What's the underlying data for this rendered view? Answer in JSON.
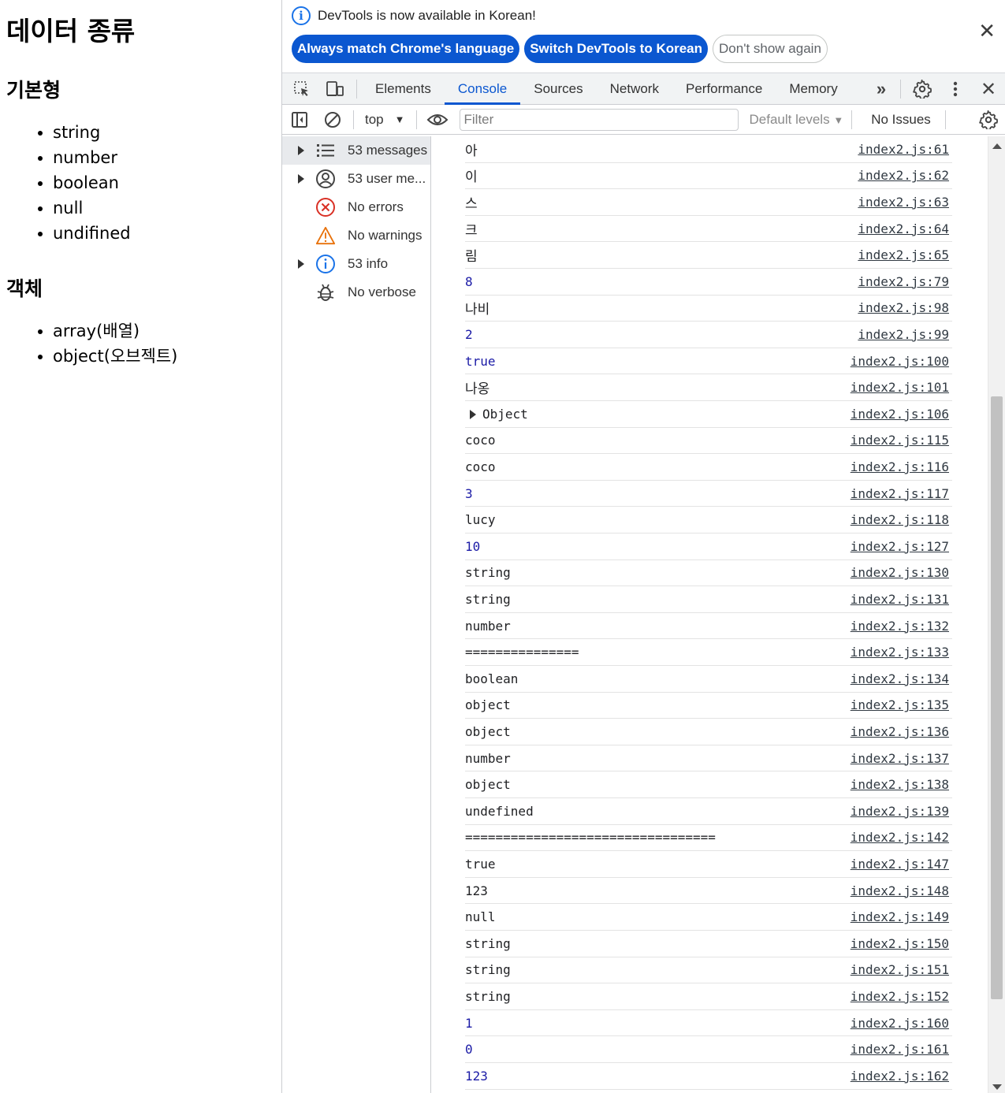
{
  "page": {
    "title": "데이터 종류",
    "section1_title": "기본형",
    "primitives": [
      "string",
      "number",
      "boolean",
      "null",
      "undifined"
    ],
    "section2_title": "객체",
    "objects": [
      "array(배열)",
      "object(오브젝트)"
    ]
  },
  "infobar": {
    "message": "DevTools is now available in Korean!",
    "btn_match": "Always match Chrome's language",
    "btn_switch": "Switch DevTools to Korean",
    "btn_dismiss": "Don't show again"
  },
  "tabs": [
    "Elements",
    "Console",
    "Sources",
    "Network",
    "Performance",
    "Memory"
  ],
  "active_tab": "Console",
  "toolbar": {
    "context": "top",
    "filter_placeholder": "Filter",
    "levels": "Default levels",
    "issues": "No Issues"
  },
  "sidebar": [
    {
      "label": "53 messages",
      "icon": "list-icon",
      "expandable": true
    },
    {
      "label": "53 user me...",
      "icon": "user-icon",
      "expandable": true
    },
    {
      "label": "No errors",
      "icon": "error-icon",
      "expandable": false
    },
    {
      "label": "No warnings",
      "icon": "warning-icon",
      "expandable": false
    },
    {
      "label": "53 info",
      "icon": "info-icon",
      "expandable": true
    },
    {
      "label": "No verbose",
      "icon": "bug-icon",
      "expandable": false
    }
  ],
  "console_rows": [
    {
      "text": "아",
      "src": "index2.js:61",
      "kind": "kr"
    },
    {
      "text": "이",
      "src": "index2.js:62",
      "kind": "kr"
    },
    {
      "text": "스",
      "src": "index2.js:63",
      "kind": "kr"
    },
    {
      "text": "크",
      "src": "index2.js:64",
      "kind": "kr"
    },
    {
      "text": "림",
      "src": "index2.js:65",
      "kind": "kr"
    },
    {
      "text": "8",
      "src": "index2.js:79",
      "kind": "num"
    },
    {
      "text": "나비",
      "src": "index2.js:98",
      "kind": "kr"
    },
    {
      "text": "2",
      "src": "index2.js:99",
      "kind": "num"
    },
    {
      "text": "true",
      "src": "index2.js:100",
      "kind": "bool"
    },
    {
      "text": "나옹",
      "src": "index2.js:101",
      "kind": "kr"
    },
    {
      "text": "Object",
      "src": "index2.js:106",
      "kind": "obj"
    },
    {
      "text": "coco",
      "src": "index2.js:115",
      "kind": "str"
    },
    {
      "text": "coco",
      "src": "index2.js:116",
      "kind": "str"
    },
    {
      "text": "3",
      "src": "index2.js:117",
      "kind": "num"
    },
    {
      "text": "lucy",
      "src": "index2.js:118",
      "kind": "str"
    },
    {
      "text": "10",
      "src": "index2.js:127",
      "kind": "num"
    },
    {
      "text": "string",
      "src": "index2.js:130",
      "kind": "str"
    },
    {
      "text": "string",
      "src": "index2.js:131",
      "kind": "str"
    },
    {
      "text": "number",
      "src": "index2.js:132",
      "kind": "str"
    },
    {
      "text": "===============",
      "src": "index2.js:133",
      "kind": "str"
    },
    {
      "text": "boolean",
      "src": "index2.js:134",
      "kind": "str"
    },
    {
      "text": "object",
      "src": "index2.js:135",
      "kind": "str"
    },
    {
      "text": "object",
      "src": "index2.js:136",
      "kind": "str"
    },
    {
      "text": "number",
      "src": "index2.js:137",
      "kind": "str"
    },
    {
      "text": "object",
      "src": "index2.js:138",
      "kind": "str"
    },
    {
      "text": "undefined",
      "src": "index2.js:139",
      "kind": "str"
    },
    {
      "text": "=================================",
      "src": "index2.js:142",
      "kind": "str"
    },
    {
      "text": "true",
      "src": "index2.js:147",
      "kind": "str"
    },
    {
      "text": "123",
      "src": "index2.js:148",
      "kind": "str"
    },
    {
      "text": "null",
      "src": "index2.js:149",
      "kind": "str"
    },
    {
      "text": "string",
      "src": "index2.js:150",
      "kind": "str"
    },
    {
      "text": "string",
      "src": "index2.js:151",
      "kind": "str"
    },
    {
      "text": "string",
      "src": "index2.js:152",
      "kind": "str"
    },
    {
      "text": "1",
      "src": "index2.js:160",
      "kind": "num"
    },
    {
      "text": "0",
      "src": "index2.js:161",
      "kind": "num"
    },
    {
      "text": "123",
      "src": "index2.js:162",
      "kind": "num"
    }
  ],
  "colors": {
    "accent": "#0b57d0",
    "error": "#d93025",
    "warning": "#e8710a",
    "info": "#1a73e8"
  }
}
